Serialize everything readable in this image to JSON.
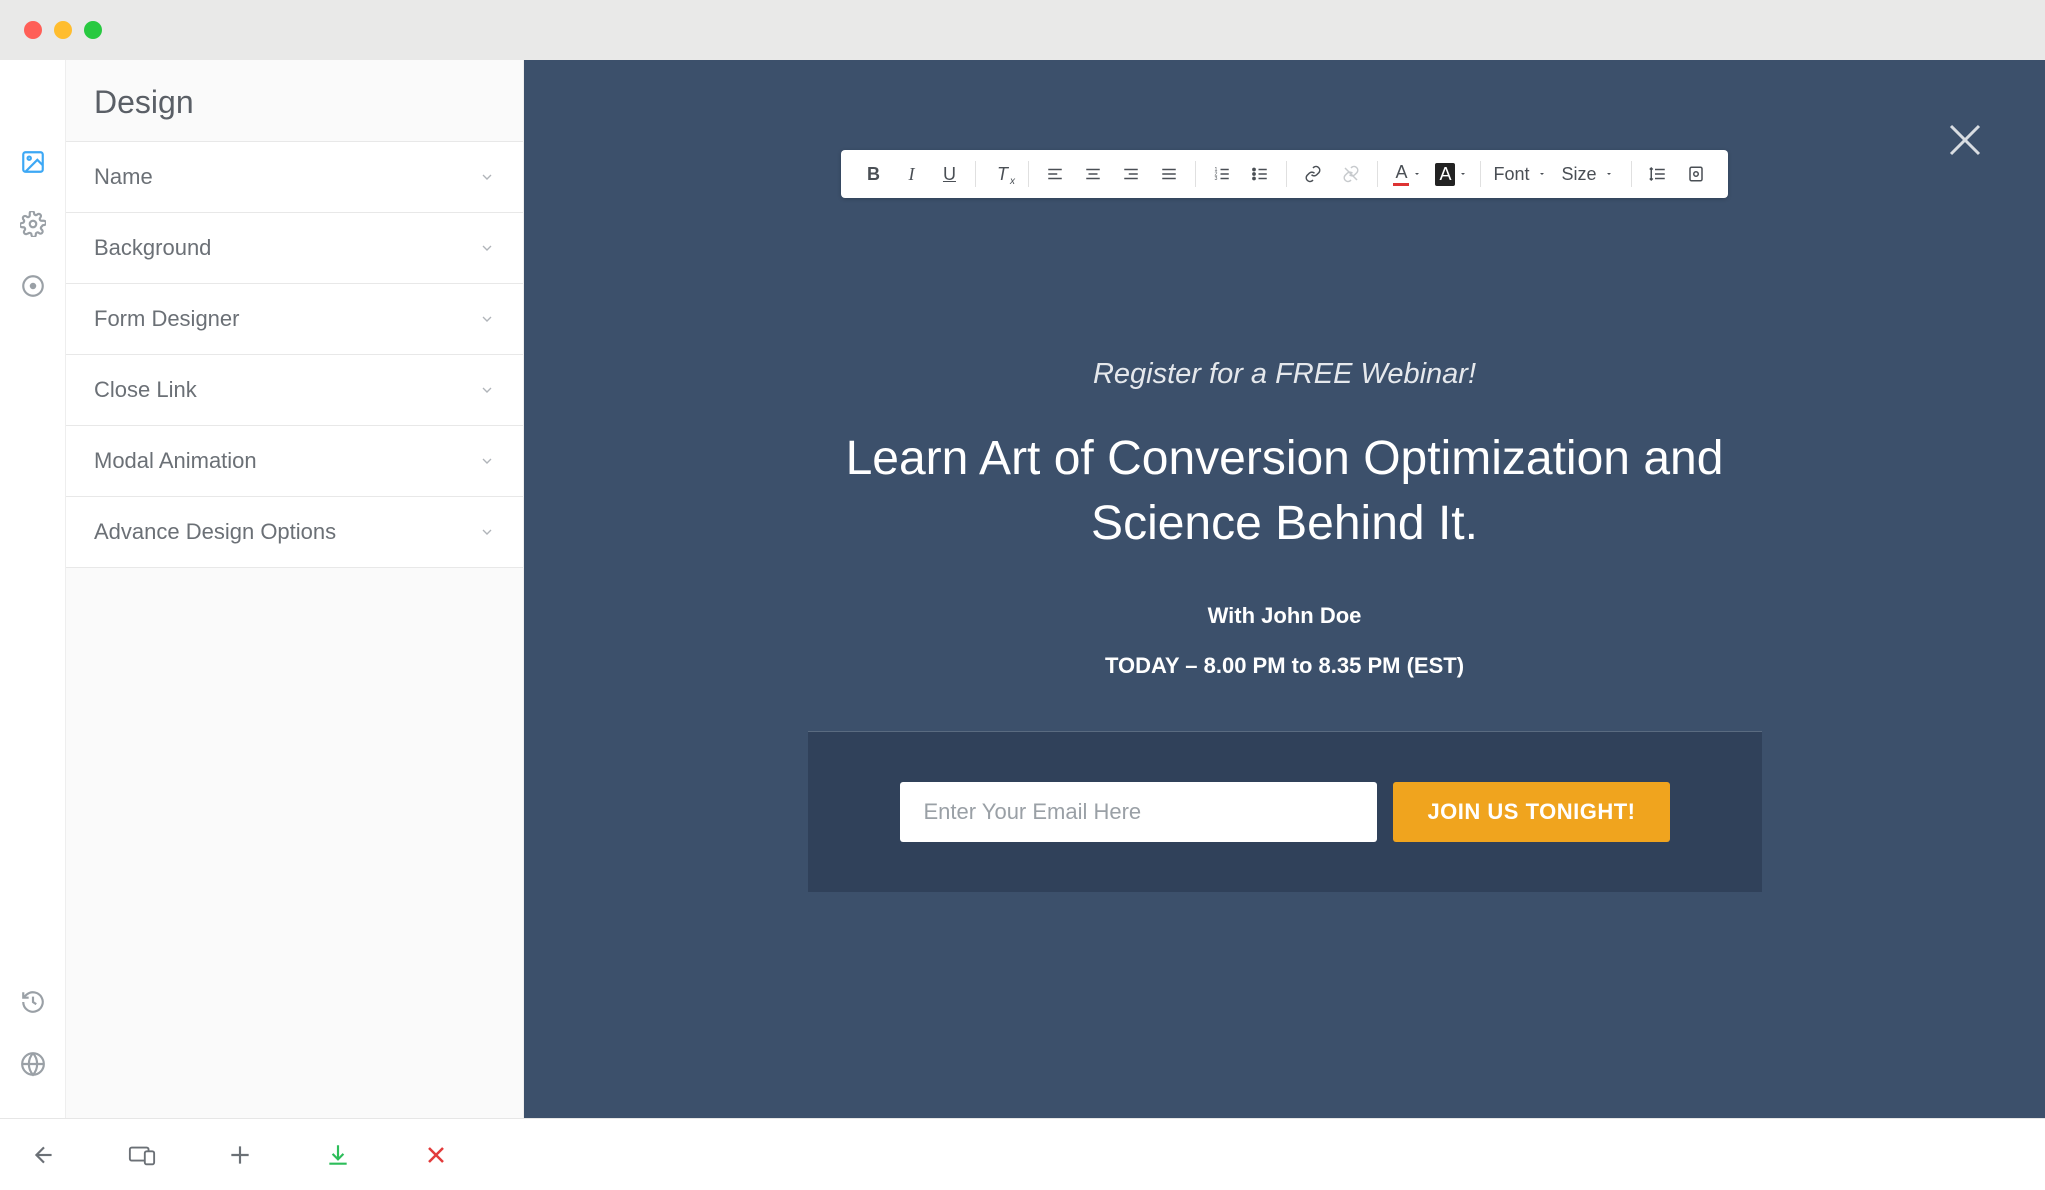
{
  "sidebar": {
    "title": "Design",
    "items": [
      {
        "label": "Name"
      },
      {
        "label": "Background"
      },
      {
        "label": "Form Designer"
      },
      {
        "label": "Close Link"
      },
      {
        "label": "Modal Animation"
      },
      {
        "label": "Advance Design Options"
      }
    ]
  },
  "toolbar": {
    "font_label": "Font",
    "size_label": "Size"
  },
  "modal": {
    "pre_title": "Register for a FREE Webinar!",
    "title": "Learn Art of Conversion Optimization and Science Behind It.",
    "presenter": "With John Doe",
    "when": "TODAY – 8.00 PM to 8.35 PM (EST)",
    "email_placeholder": "Enter Your Email Here",
    "cta": "JOIN US TONIGHT!"
  },
  "colors": {
    "canvas_bg": "#3c506b",
    "form_bg": "#30415a",
    "cta_bg": "#f0a41e",
    "accent": "#3da8f5"
  }
}
